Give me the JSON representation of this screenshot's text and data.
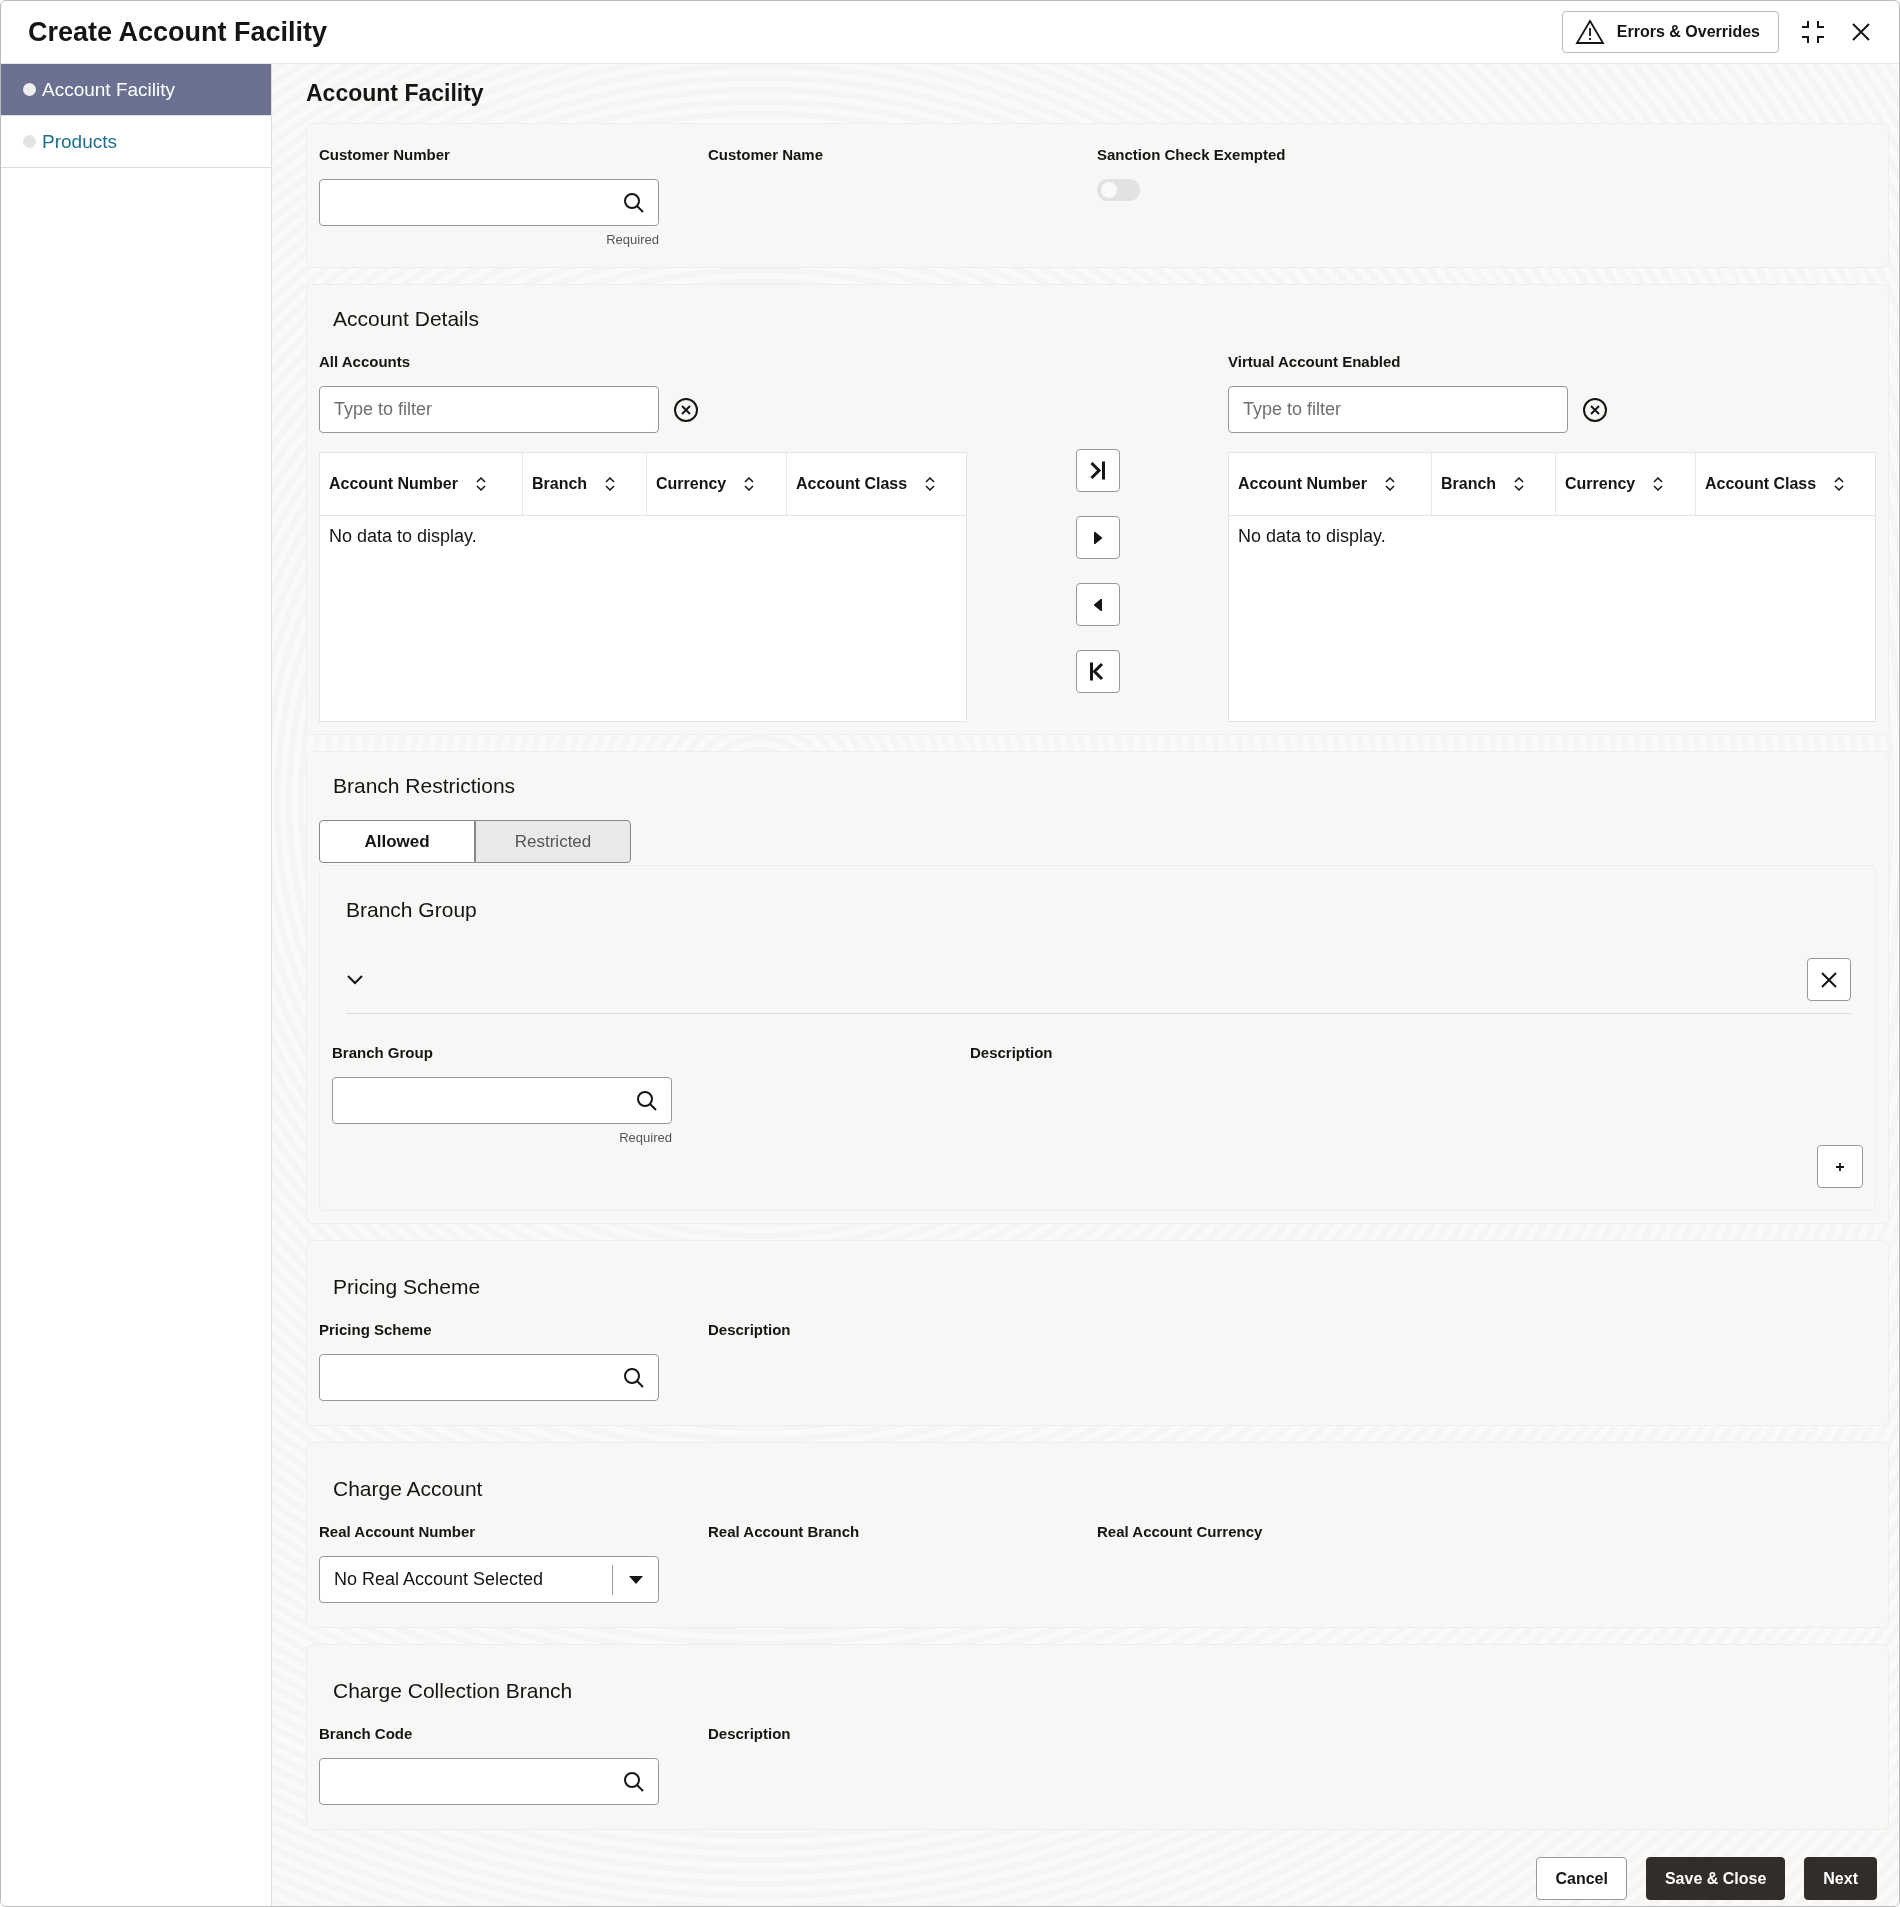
{
  "header": {
    "title": "Create Account Facility",
    "errors_button": "Errors & Overrides"
  },
  "sidebar": {
    "items": [
      {
        "label": "Account Facility",
        "selected": true
      },
      {
        "label": "Products",
        "selected": false
      }
    ]
  },
  "page_title": "Account Facility",
  "customer": {
    "customer_number": {
      "label": "Customer Number",
      "hint": "Required"
    },
    "customer_name": {
      "label": "Customer Name"
    },
    "sanction_check": {
      "label": "Sanction Check Exempted",
      "on": false
    }
  },
  "account_details": {
    "title": "Account Details",
    "lists": [
      {
        "label": "All Accounts",
        "placeholder": "Type to filter",
        "columns": [
          "Account Number",
          "Branch",
          "Currency",
          "Account Class"
        ],
        "empty": "No data to display."
      },
      {
        "label": "Virtual Account Enabled",
        "placeholder": "Type to filter",
        "columns": [
          "Account Number",
          "Branch",
          "Currency",
          "Account Class"
        ],
        "empty": "No data to display."
      }
    ]
  },
  "branch_restrictions": {
    "title": "Branch Restrictions",
    "tabs": [
      {
        "label": "Allowed",
        "selected": true
      },
      {
        "label": "Restricted",
        "selected": false
      }
    ],
    "branch_group": {
      "title": "Branch Group",
      "expanded": true,
      "field": {
        "label": "Branch Group",
        "hint": "Required"
      },
      "description": {
        "label": "Description"
      }
    }
  },
  "pricing_scheme": {
    "title": "Pricing Scheme",
    "field": {
      "label": "Pricing Scheme"
    },
    "description": {
      "label": "Description"
    }
  },
  "charge_account": {
    "title": "Charge Account",
    "real_account_number": {
      "label": "Real Account Number",
      "value": "No Real Account Selected"
    },
    "real_account_branch": {
      "label": "Real Account Branch"
    },
    "real_account_currency": {
      "label": "Real Account Currency"
    }
  },
  "charge_collection_branch": {
    "title": "Charge Collection Branch",
    "branch_code": {
      "label": "Branch Code"
    },
    "description": {
      "label": "Description"
    }
  },
  "footer": {
    "buttons": [
      {
        "label": "Cancel",
        "kind": "secondary"
      },
      {
        "label": "Save & Close",
        "kind": "primary"
      },
      {
        "label": "Next",
        "kind": "primary"
      }
    ]
  }
}
